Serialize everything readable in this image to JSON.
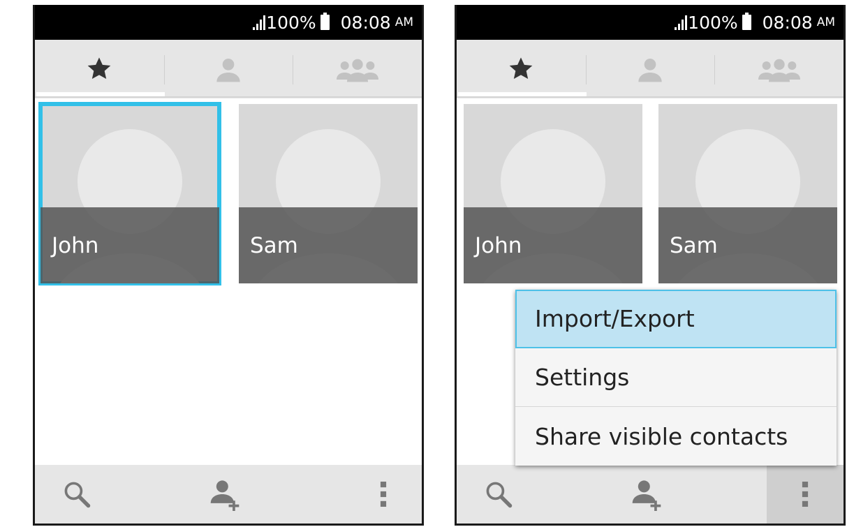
{
  "screens": [
    {
      "status": {
        "signal": "signal-icon",
        "battery_percent": "100%",
        "time": "08:08",
        "ampm": "AM"
      },
      "tabs": [
        {
          "icon": "star-icon",
          "selected": true
        },
        {
          "icon": "person-icon",
          "selected": false
        },
        {
          "icon": "group-icon",
          "selected": false
        }
      ],
      "contacts": [
        {
          "name": "John",
          "selected": true
        },
        {
          "name": "Sam",
          "selected": false
        }
      ],
      "bottom_bar": {
        "search": "search-icon",
        "add_contact": "add-contact-icon",
        "overflow": "overflow-menu-icon"
      }
    },
    {
      "status": {
        "signal": "signal-icon",
        "battery_percent": "100%",
        "time": "08:08",
        "ampm": "AM"
      },
      "tabs": [
        {
          "icon": "star-icon",
          "selected": true
        },
        {
          "icon": "person-icon",
          "selected": false
        },
        {
          "icon": "group-icon",
          "selected": false
        }
      ],
      "contacts": [
        {
          "name": "John",
          "selected": false
        },
        {
          "name": "Sam",
          "selected": false
        }
      ],
      "menu": {
        "items": [
          "Import/Export",
          "Settings",
          "Share visible contacts"
        ],
        "highlighted": "Import/Export"
      },
      "bottom_bar": {
        "search": "search-icon",
        "add_contact": "add-contact-icon",
        "overflow": "overflow-menu-icon",
        "overflow_pressed": true
      }
    }
  ],
  "colors": {
    "selection": "#32c0e8",
    "menu_highlight": "#bfe3f3",
    "bar": "#e6e6e6",
    "status_bar": "#000000"
  }
}
